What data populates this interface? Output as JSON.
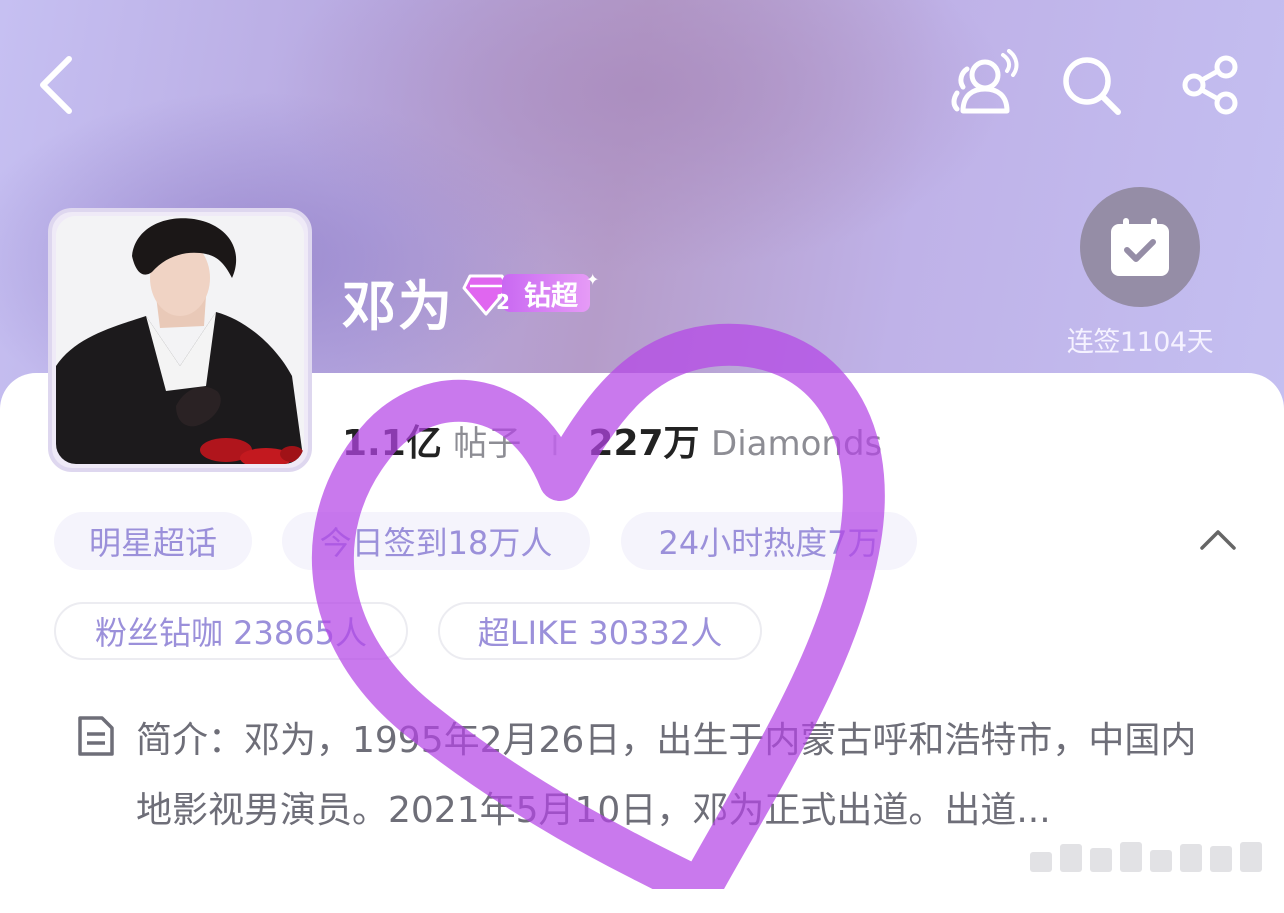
{
  "header": {
    "back_icon": "chevron-left-icon",
    "people_icon": "people-signal-icon",
    "search_icon": "search-icon",
    "share_icon": "share-icon"
  },
  "checkin": {
    "icon": "calendar-check-icon",
    "label": "连签1104天"
  },
  "profile": {
    "name": "邓为",
    "badge_label": "钻超",
    "badge_level": "2",
    "posts_value": "1.1亿",
    "posts_unit": "帖子",
    "separator": "I",
    "diamonds_value": "227万",
    "diamonds_unit": "Diamonds"
  },
  "tags": [
    {
      "label": "明星超话"
    },
    {
      "label": "今日签到18万人"
    },
    {
      "label": "24小时热度7万"
    },
    {
      "label": "粉丝钻咖 23865人"
    },
    {
      "label": "超LIKE 30332人"
    }
  ],
  "intro": {
    "icon": "document-icon",
    "text": "简介：邓为，1995年2月26日，出生于内蒙古呼和浩特市，中国内地影视男演员。2021年5月10日，邓为正式出道。出道..."
  },
  "colors": {
    "accent": "#9b90da",
    "badge": "#c968f2",
    "heart": "#b445e6"
  }
}
